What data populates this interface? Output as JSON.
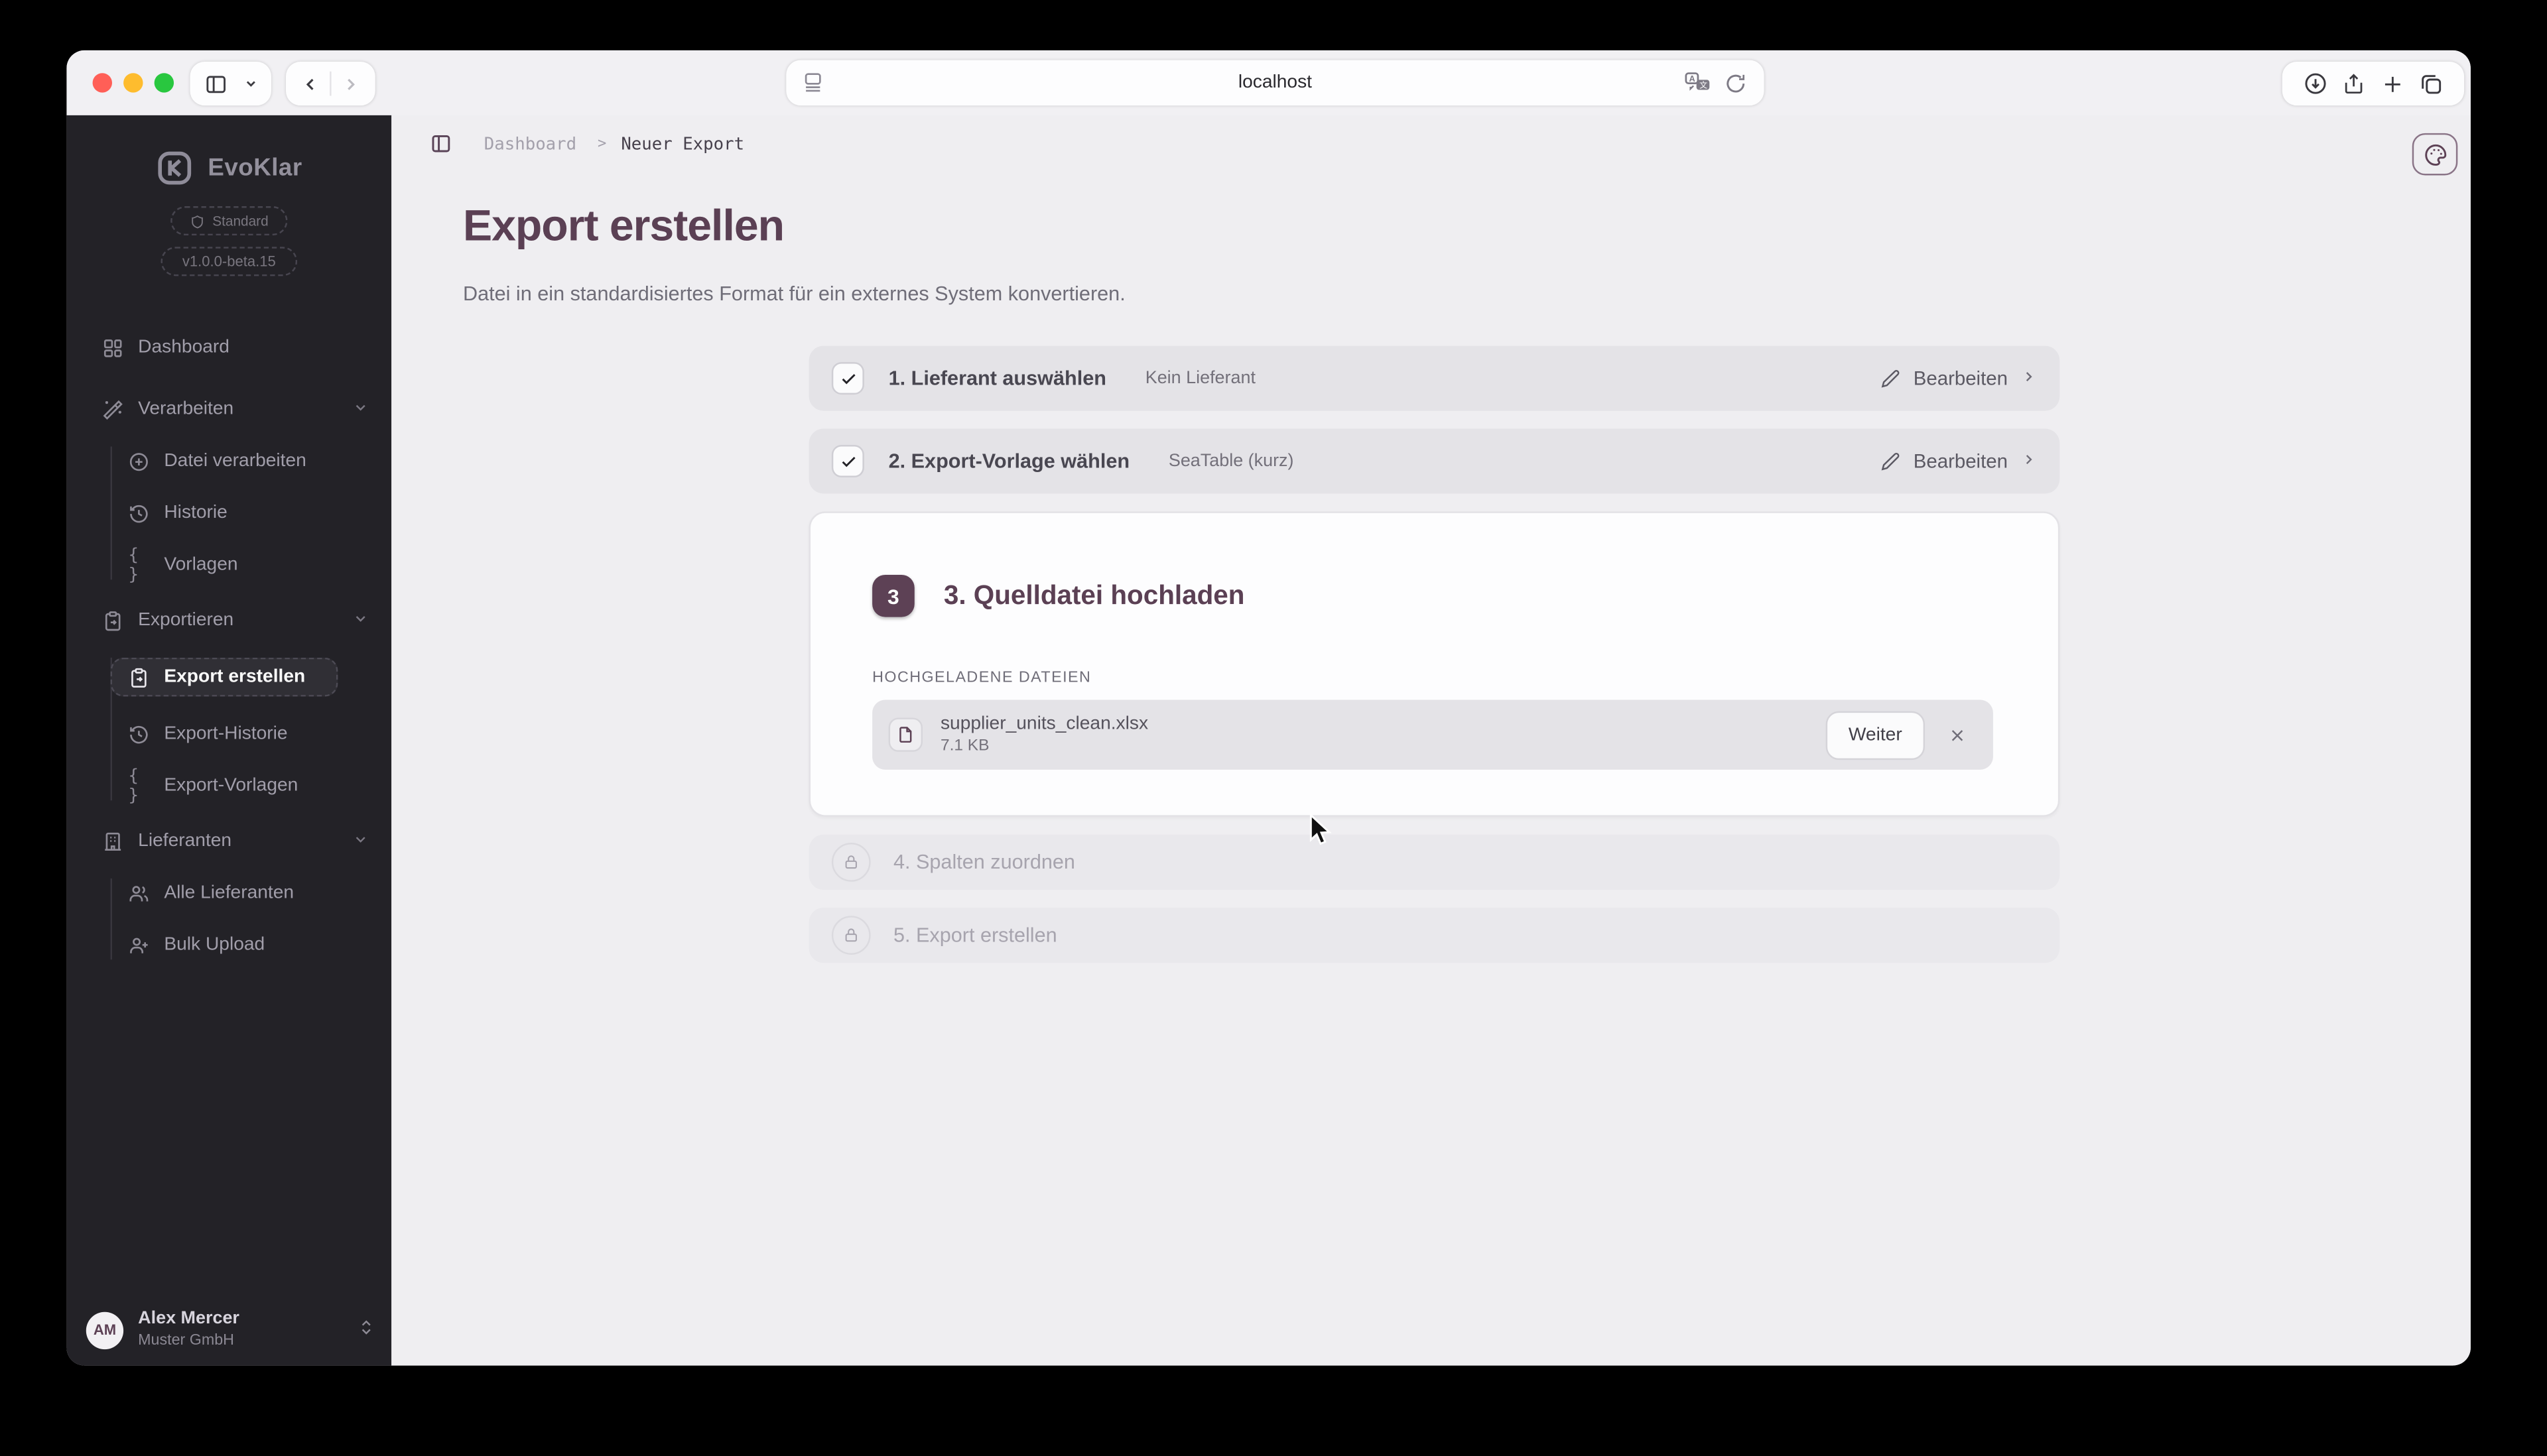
{
  "browser": {
    "address": "localhost"
  },
  "sidebar": {
    "app_name": "EvoKlar",
    "plan_badge": "Standard",
    "version": "v1.0.0-beta.15",
    "nav": {
      "dashboard": "Dashboard",
      "verarbeiten": "Verarbeiten",
      "datei_verarbeiten": "Datei verarbeiten",
      "historie": "Historie",
      "vorlagen": "Vorlagen",
      "exportieren": "Exportieren",
      "export_erstellen": "Export erstellen",
      "export_historie": "Export-Historie",
      "export_vorlagen": "Export-Vorlagen",
      "lieferanten": "Lieferanten",
      "alle_lieferanten": "Alle Lieferanten",
      "bulk_upload": "Bulk Upload"
    },
    "user": {
      "initials": "AM",
      "name": "Alex Mercer",
      "company": "Muster GmbH"
    }
  },
  "breadcrumb": {
    "parent": "Dashboard",
    "separator": ">",
    "current": "Neuer Export"
  },
  "page": {
    "title": "Export erstellen",
    "subtitle": "Datei in ein standardisiertes Format für ein externes System konvertieren."
  },
  "steps": {
    "one": {
      "title": "1. Lieferant auswählen",
      "value": "Kein Lieferant",
      "action": "Bearbeiten"
    },
    "two": {
      "title": "2. Export-Vorlage wählen",
      "value": "SeaTable (kurz)",
      "action": "Bearbeiten"
    },
    "three": {
      "badge": "3",
      "title": "3. Quelldatei hochladen",
      "files_label": "HOCHGELADENE DATEIEN",
      "file": {
        "name": "supplier_units_clean.xlsx",
        "size": "7.1 KB"
      },
      "action": "Weiter"
    },
    "four": {
      "title": "4. Spalten zuordnen"
    },
    "five": {
      "title": "5. Export erstellen"
    }
  },
  "icons": {
    "braces_glyph": "{ }"
  },
  "colors": {
    "accent": "#5d4155",
    "sidebar_bg": "#232227",
    "content_bg": "#efeef1",
    "row_bg": "#e4e3e7"
  }
}
